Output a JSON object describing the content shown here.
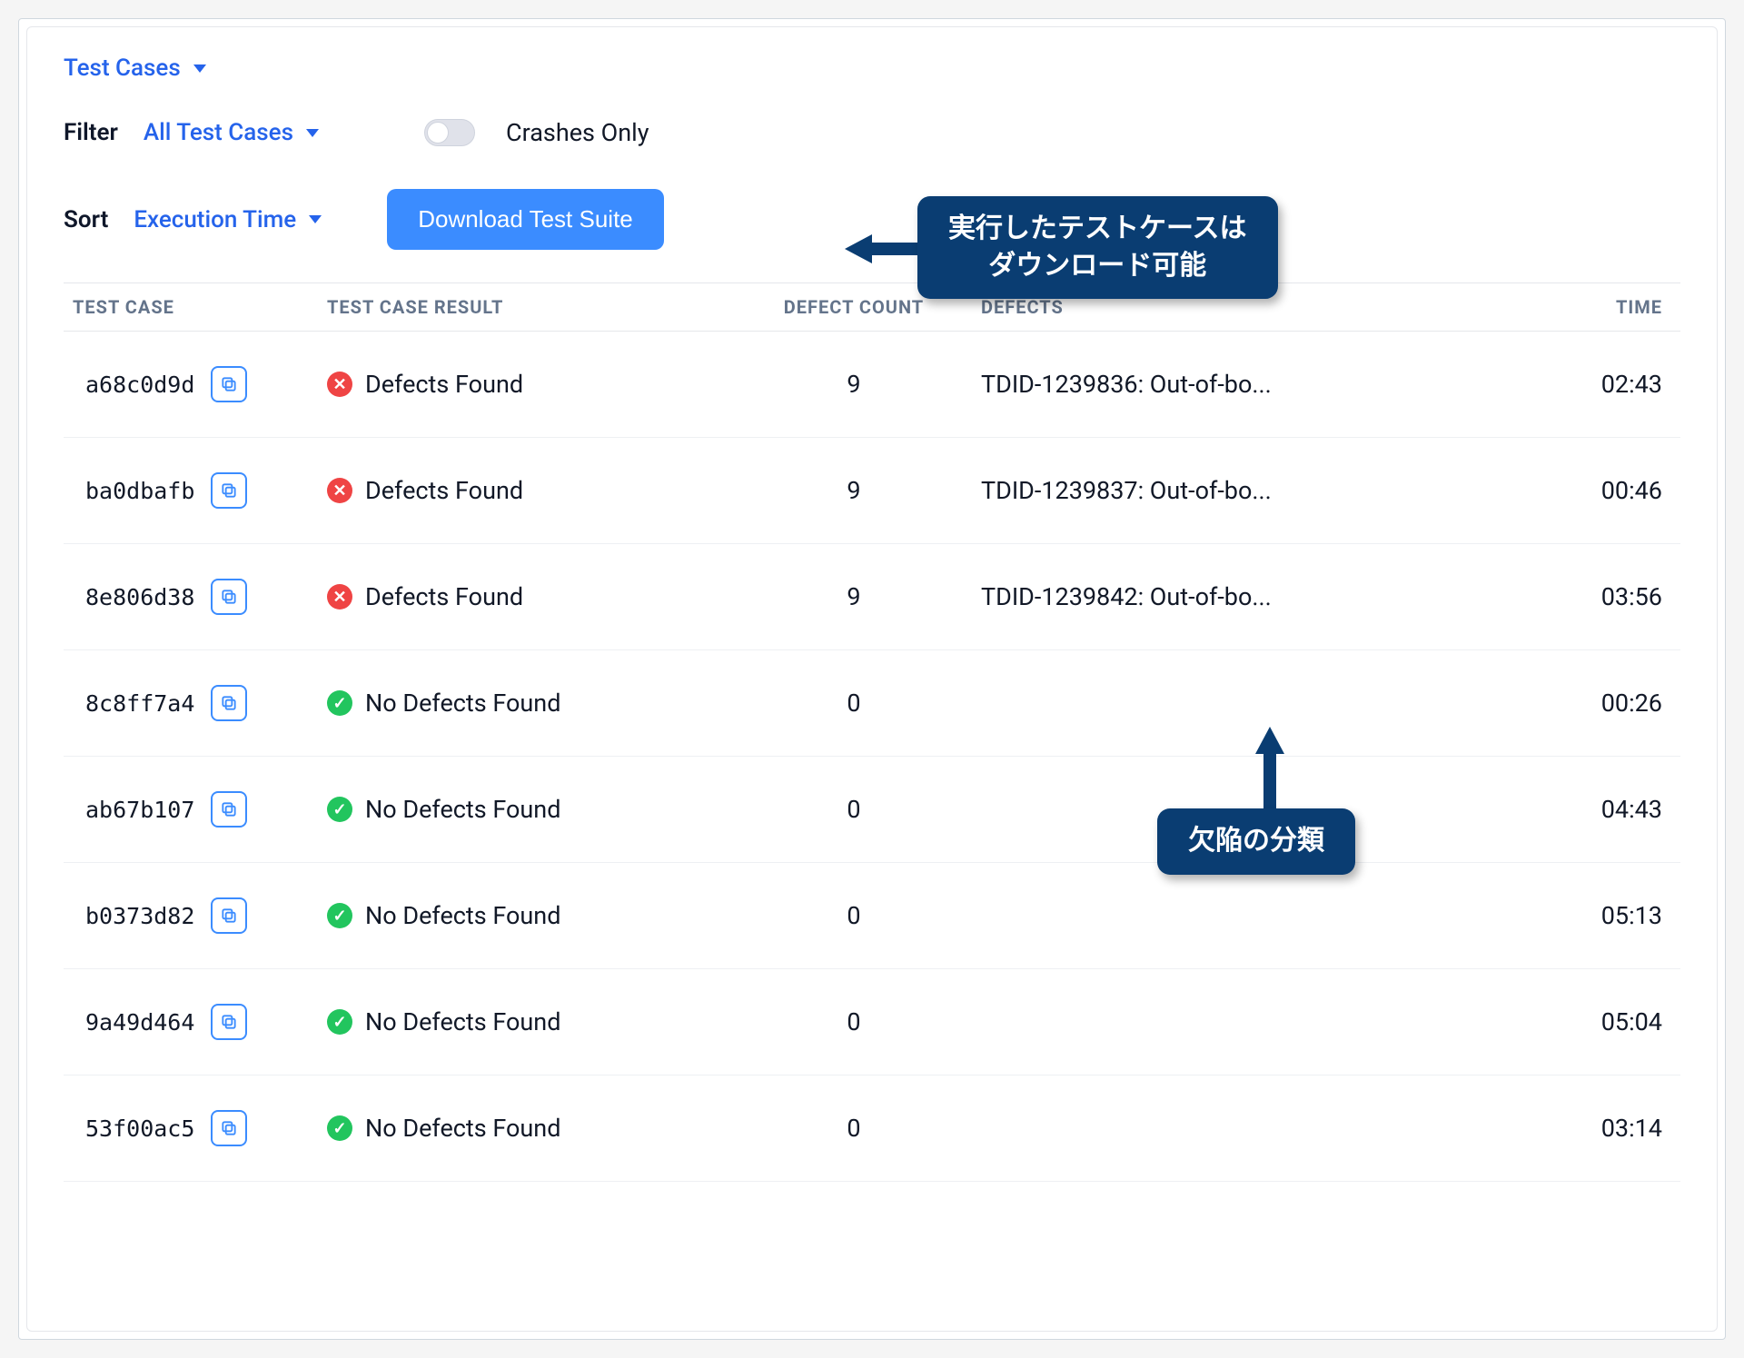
{
  "header": {
    "viewSelector": "Test Cases"
  },
  "filter": {
    "label": "Filter",
    "value": "All Test Cases",
    "crashesOnlyLabel": "Crashes Only"
  },
  "sort": {
    "label": "Sort",
    "value": "Execution Time"
  },
  "buttons": {
    "download": "Download Test Suite"
  },
  "columns": {
    "testCase": "TEST CASE",
    "result": "TEST CASE RESULT",
    "defectCount": "DEFECT COUNT",
    "defects": "DEFECTS",
    "time": "TIME"
  },
  "resultLabels": {
    "defectsFound": "Defects Found",
    "noDefectsFound": "No Defects Found"
  },
  "rows": [
    {
      "id": "a68c0d9d",
      "status": "fail",
      "count": "9",
      "defects": "TDID-1239836: Out-of-bo...",
      "time": "02:43"
    },
    {
      "id": "ba0dbafb",
      "status": "fail",
      "count": "9",
      "defects": "TDID-1239837: Out-of-bo...",
      "time": "00:46"
    },
    {
      "id": "8e806d38",
      "status": "fail",
      "count": "9",
      "defects": "TDID-1239842: Out-of-bo...",
      "time": "03:56"
    },
    {
      "id": "8c8ff7a4",
      "status": "pass",
      "count": "0",
      "defects": "",
      "time": "00:26"
    },
    {
      "id": "ab67b107",
      "status": "pass",
      "count": "0",
      "defects": "",
      "time": "04:43"
    },
    {
      "id": "b0373d82",
      "status": "pass",
      "count": "0",
      "defects": "",
      "time": "05:13"
    },
    {
      "id": "9a49d464",
      "status": "pass",
      "count": "0",
      "defects": "",
      "time": "05:04"
    },
    {
      "id": "53f00ac5",
      "status": "pass",
      "count": "0",
      "defects": "",
      "time": "03:14"
    }
  ],
  "callouts": {
    "download": "実行したテストケースは\nダウンロード可能",
    "defects": "欠陥の分類"
  }
}
